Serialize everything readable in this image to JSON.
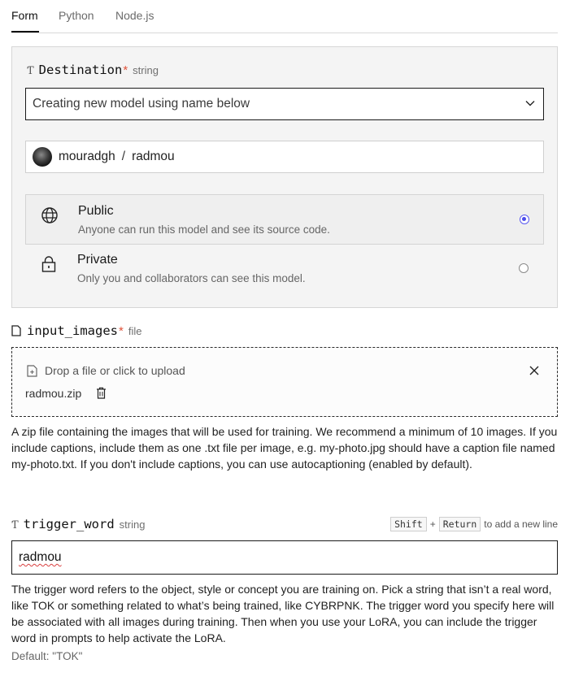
{
  "tabs": [
    {
      "label": "Form",
      "active": true
    },
    {
      "label": "Python",
      "active": false
    },
    {
      "label": "Node.js",
      "active": false
    }
  ],
  "destination": {
    "label": "Destination",
    "required_mark": "*",
    "type": "string",
    "select_value": "Creating new model using name below",
    "owner": "mouradgh",
    "separator": "/",
    "model_name": "radmou",
    "visibility": [
      {
        "title": "Public",
        "description": "Anyone can run this model and see its source code.",
        "selected": true,
        "icon": "globe-icon"
      },
      {
        "title": "Private",
        "description": "Only you and collaborators can see this model.",
        "selected": false,
        "icon": "lock-icon"
      }
    ]
  },
  "input_images": {
    "label": "input_images",
    "required_mark": "*",
    "type": "file",
    "drop_text": "Drop a file or click to upload",
    "file_name": "radmou.zip",
    "description": "A zip file containing the images that will be used for training. We recommend a minimum of 10 images. If you include captions, include them as one .txt file per image, e.g. my-photo.jpg should have a caption file named my-photo.txt. If you don't include captions, you can use autocaptioning (enabled by default)."
  },
  "trigger_word": {
    "label": "trigger_word",
    "type": "string",
    "hint_key1": "Shift",
    "hint_plus": "+",
    "hint_key2": "Return",
    "hint_text": "to add a new line",
    "value": "radmou",
    "description": "The trigger word refers to the object, style or concept you are training on. Pick a string that isn’t a real word, like TOK or something related to what’s being trained, like CYBRPNK. The trigger word you specify here will be associated with all images during training. Then when you use your LoRA, you can include the trigger word in prompts to help activate the LoRA.",
    "default_text": "Default: \"TOK\""
  },
  "colors": {
    "accent": "#4b4bea",
    "required": "#e0533b",
    "panel_bg": "#f4f4f4"
  }
}
